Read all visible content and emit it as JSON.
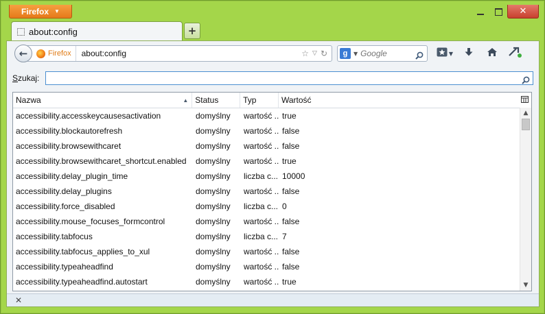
{
  "titlebar": {
    "app_button_label": "Firefox"
  },
  "tab": {
    "label": "about:config"
  },
  "navbar": {
    "identity_label": "Firefox",
    "url": "about:config",
    "search_placeholder": "Google"
  },
  "filter": {
    "label_underlined": "S",
    "label_rest": "zukaj:",
    "value": ""
  },
  "table": {
    "columns": {
      "name": "Nazwa",
      "status": "Status",
      "type": "Typ",
      "value": "Wartość"
    },
    "rows": [
      {
        "name": "accessibility.accesskeycausesactivation",
        "status": "domyślny",
        "type": "wartość ...",
        "value": "true"
      },
      {
        "name": "accessibility.blockautorefresh",
        "status": "domyślny",
        "type": "wartość ...",
        "value": "false"
      },
      {
        "name": "accessibility.browsewithcaret",
        "status": "domyślny",
        "type": "wartość ...",
        "value": "false"
      },
      {
        "name": "accessibility.browsewithcaret_shortcut.enabled",
        "status": "domyślny",
        "type": "wartość ...",
        "value": "true"
      },
      {
        "name": "accessibility.delay_plugin_time",
        "status": "domyślny",
        "type": "liczba c...",
        "value": "10000"
      },
      {
        "name": "accessibility.delay_plugins",
        "status": "domyślny",
        "type": "wartość ...",
        "value": "false"
      },
      {
        "name": "accessibility.force_disabled",
        "status": "domyślny",
        "type": "liczba c...",
        "value": "0"
      },
      {
        "name": "accessibility.mouse_focuses_formcontrol",
        "status": "domyślny",
        "type": "wartość ...",
        "value": "false"
      },
      {
        "name": "accessibility.tabfocus",
        "status": "domyślny",
        "type": "liczba c...",
        "value": "7"
      },
      {
        "name": "accessibility.tabfocus_applies_to_xul",
        "status": "domyślny",
        "type": "wartość ...",
        "value": "false"
      },
      {
        "name": "accessibility.typeaheadfind",
        "status": "domyślny",
        "type": "wartość ...",
        "value": "false"
      },
      {
        "name": "accessibility.typeaheadfind.autostart",
        "status": "domyślny",
        "type": "wartość ...",
        "value": "true"
      }
    ]
  },
  "icons": {
    "back": "back-arrow-icon",
    "bookmark_star": "star-icon",
    "history": "history-dropdown-icon",
    "reload": "reload-icon",
    "search_engine": "google-icon",
    "search_go": "magnifier-icon",
    "bookmarks_menu": "bookmarks-menu-icon",
    "downloads": "download-arrow-icon",
    "home": "home-icon",
    "sync": "sync-icon",
    "column_picker": "column-picker-icon",
    "close_addonbar": "close-icon"
  },
  "colors": {
    "window_frame": "#a4d64a",
    "firefox_button": "#e6791a",
    "close_button": "#c8402e",
    "filter_focus": "#4b8fd0"
  }
}
